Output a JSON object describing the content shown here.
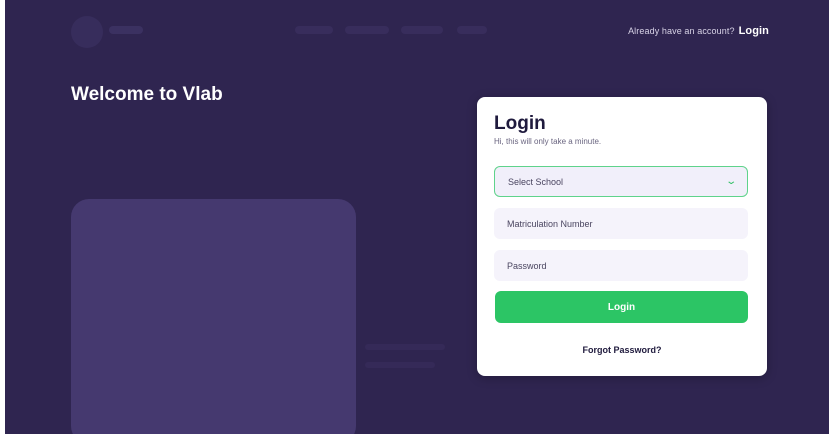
{
  "header": {
    "account_prompt": "Already have an account?",
    "login_link": "Login"
  },
  "hero": {
    "welcome": "Welcome to Vlab"
  },
  "login_card": {
    "title": "Login",
    "subtitle": "Hi, this will only take a minute.",
    "school_select": {
      "value": "Select School"
    },
    "matric_field": {
      "placeholder": "Matriculation Number"
    },
    "password_field": {
      "placeholder": "Password"
    },
    "submit_label": "Login",
    "forgot_label": "Forgot Password?"
  },
  "colors": {
    "background": "#2f2550",
    "illustration_panel": "#45396f",
    "primary_button": "#2cc565",
    "select_border": "#5fd38b"
  }
}
